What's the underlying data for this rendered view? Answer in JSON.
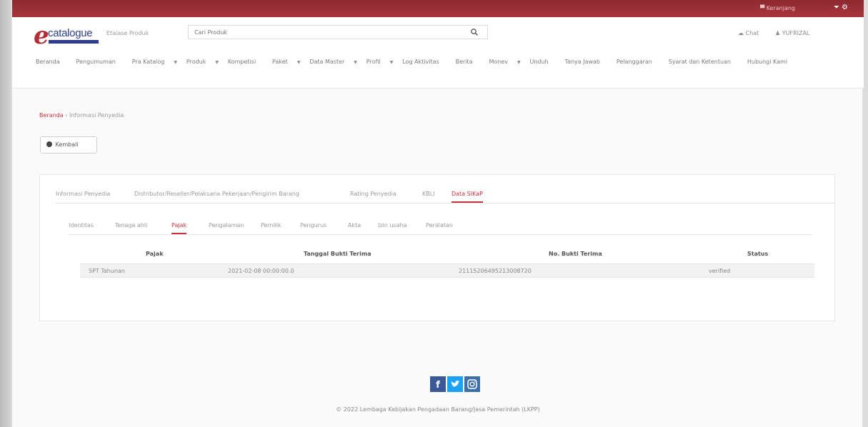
{
  "topbar": {
    "cart_label": "Keranjang",
    "user_label": "⏷ ⚙"
  },
  "header": {
    "logo_text": "catalogue",
    "logo_e": "e",
    "etalase_label": "Etalase Produk",
    "search_placeholder": "Cari Produk",
    "chat_label": "Chat",
    "user_menu_label": "YUFRIZAL"
  },
  "nav": {
    "items": [
      {
        "label": "Beranda",
        "dropdown": false
      },
      {
        "label": "Pengumuman",
        "dropdown": false
      },
      {
        "label": "Pra Katalog",
        "dropdown": true
      },
      {
        "label": "Produk",
        "dropdown": true
      },
      {
        "label": "Kompetisi",
        "dropdown": false
      },
      {
        "label": "Paket",
        "dropdown": true
      },
      {
        "label": "Data Master",
        "dropdown": true
      },
      {
        "label": "Profil",
        "dropdown": true
      },
      {
        "label": "Log Aktivitas",
        "dropdown": false
      },
      {
        "label": "Berita",
        "dropdown": false
      },
      {
        "label": "Monev",
        "dropdown": true
      },
      {
        "label": "Unduh",
        "dropdown": false
      },
      {
        "label": "Tanya Jawab",
        "dropdown": false
      },
      {
        "label": "Pelanggaran",
        "dropdown": false
      },
      {
        "label": "Syarat dan Ketentuan",
        "dropdown": false
      },
      {
        "label": "Hubungi Kami",
        "dropdown": false
      }
    ]
  },
  "breadcrumb": {
    "home": "Beranda",
    "separator": "›",
    "current": "Informasi Penyedia"
  },
  "back_button": {
    "label": "Kembali"
  },
  "tabs_main": [
    {
      "label": "Informasi Penyedia"
    },
    {
      "label": "Distributor/Reseller/Pelaksana Pekerjaan/Pengirim Barang"
    },
    {
      "label": "Rating Penyedia"
    },
    {
      "label": "KBLI"
    },
    {
      "label": "Data SIKaP"
    }
  ],
  "tabs_sub": [
    {
      "label": "Identitas"
    },
    {
      "label": "Tenaga ahli"
    },
    {
      "label": "Pajak"
    },
    {
      "label": "Pengalaman"
    },
    {
      "label": "Pemilik"
    },
    {
      "label": "Pengurus"
    },
    {
      "label": "Akta"
    },
    {
      "label": "Izin usaha"
    },
    {
      "label": "Peralatan"
    }
  ],
  "table": {
    "headers": [
      "Pajak",
      "Tanggal Bukti Terima",
      "No. Bukti Terima",
      "Status"
    ],
    "rows": [
      [
        "SPT Tahunan",
        "2021-02-08 00:00:00.0",
        "21115206495213008720",
        "verified"
      ]
    ]
  },
  "footer": {
    "copyright": "© 2022 Lembaga Kebijakan Pengadaan Barang/Jasa Pemerintah (LKPP)",
    "social": [
      "facebook-icon",
      "twitter-icon",
      "instagram-icon"
    ]
  },
  "colors": {
    "topbar": "#9b2f37",
    "accent": "#c8343d",
    "logo_blue": "#2d3e8f",
    "facebook": "#3b5998",
    "twitter": "#1da1f2",
    "instagram": "#3f6fa8"
  }
}
